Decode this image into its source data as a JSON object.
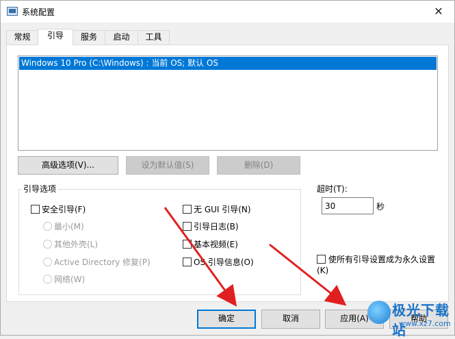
{
  "window": {
    "title": "系统配置",
    "close_glyph": "✕"
  },
  "tabs": [
    {
      "label": "常规"
    },
    {
      "label": "引导"
    },
    {
      "label": "服务"
    },
    {
      "label": "启动"
    },
    {
      "label": "工具"
    }
  ],
  "active_tab": "引导",
  "os_list": {
    "items": [
      "Windows 10 Pro (C:\\Windows) : 当前 OS; 默认 OS"
    ]
  },
  "os_buttons": {
    "advanced": "高级选项(V)...",
    "set_default": "设为默认值(S)",
    "delete": "删除(D)"
  },
  "boot_options": {
    "legend": "引导选项",
    "safe_boot": "安全引导(F)",
    "minimal": "最小(M)",
    "alt_shell": "其他外壳(L)",
    "ad_repair": "Active Directory 修复(P)",
    "network": "网络(W)",
    "no_gui": "无 GUI 引导(N)",
    "boot_log": "引导日志(B)",
    "base_video": "基本视频(E)",
    "os_info": "OS 引导信息(O)"
  },
  "timeout": {
    "label": "超时(T):",
    "value": "30",
    "unit": "秒"
  },
  "permanent": {
    "label": "使所有引导设置成为永久设置(K)"
  },
  "dialog_buttons": {
    "ok": "确定",
    "cancel": "取消",
    "apply": "应用(A)",
    "help": "帮助"
  },
  "watermark": {
    "title": "极光下载站",
    "url": "www.xz7.com"
  },
  "colors": {
    "selection": "#0078d7",
    "arrow": "#e02020"
  }
}
